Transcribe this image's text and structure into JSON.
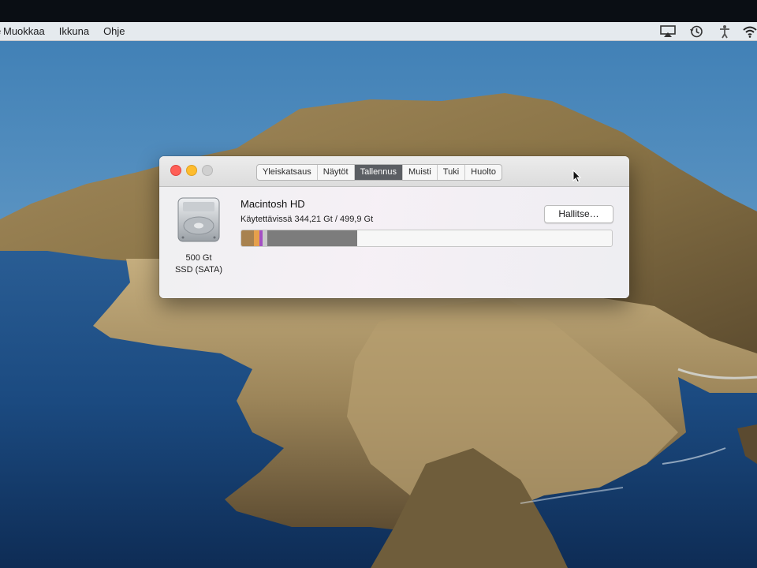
{
  "menubar": {
    "cut_item": "e",
    "items": [
      {
        "label": "Muokkaa"
      },
      {
        "label": "Ikkuna"
      },
      {
        "label": "Ohje"
      }
    ],
    "status_icons": [
      "airplay-icon",
      "time-machine-icon",
      "accessibility-icon",
      "wifi-icon"
    ]
  },
  "window": {
    "tabs": [
      {
        "label": "Yleiskatsaus",
        "active": false
      },
      {
        "label": "Näytöt",
        "active": false
      },
      {
        "label": "Tallennus",
        "active": true
      },
      {
        "label": "Muisti",
        "active": false
      },
      {
        "label": "Tuki",
        "active": false
      },
      {
        "label": "Huolto",
        "active": false
      }
    ],
    "disk": {
      "size": "500 Gt",
      "type": "SSD (SATA)",
      "icon": "hard-drive-icon"
    },
    "volume": {
      "name": "Macintosh HD",
      "available": "Käytettävissä 344,21 Gt / 499,9 Gt"
    },
    "manage_label": "Hallitse…",
    "storage_bar": {
      "total_gb": 499.9,
      "available_gb": 344.21,
      "segments": [
        {
          "fraction": 0.035,
          "color": "#a8824f"
        },
        {
          "fraction": 0.014,
          "color": "#e6a04b"
        },
        {
          "fraction": 0.008,
          "color": "#a450c4"
        },
        {
          "fraction": 0.012,
          "color": "#c9c9c9"
        },
        {
          "fraction": 0.243,
          "color": "#7c7c7c"
        }
      ]
    }
  },
  "colors": {
    "menubar": "#eceef0",
    "active_tab": "#5b5e63",
    "close": "#ff5f57",
    "minimize": "#febc2e"
  }
}
